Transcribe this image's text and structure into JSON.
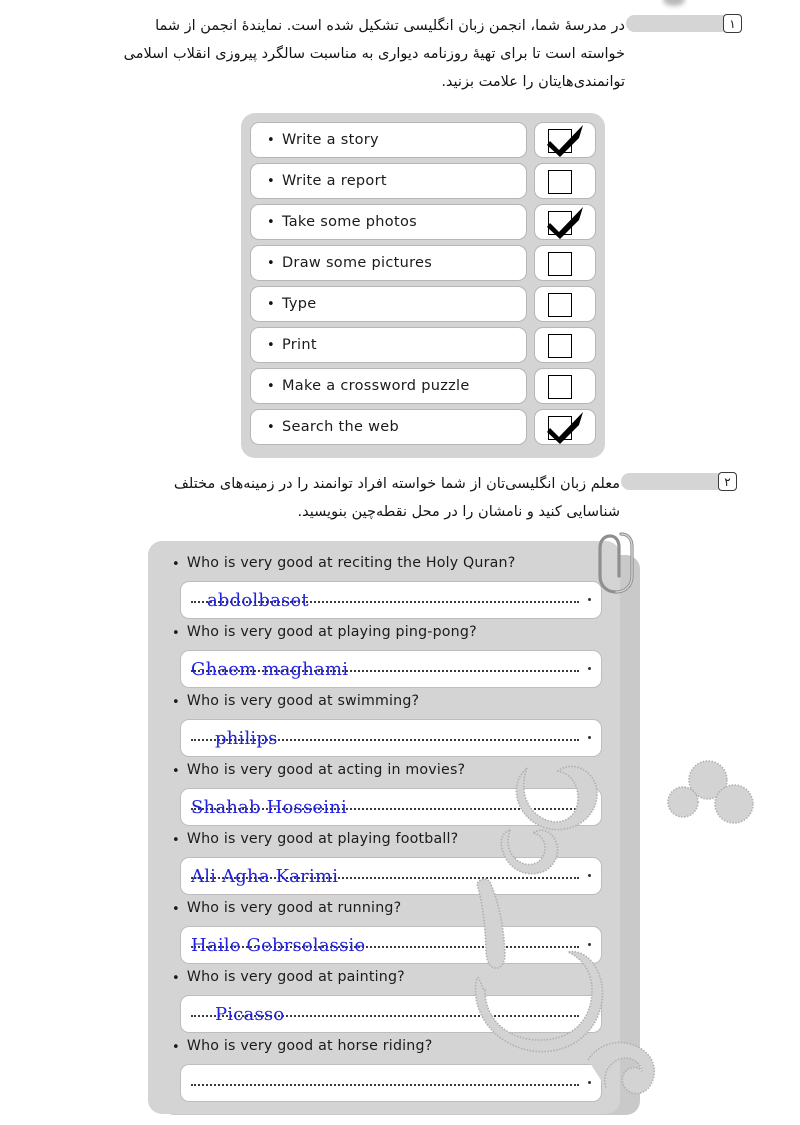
{
  "page": {
    "background_color": "#ffffff",
    "panel_color": "#d4d4d4",
    "field_color": "#ffffff",
    "answer_ink_color": "#2020e0",
    "text_color": "#1b1b1b"
  },
  "exercise1": {
    "number_badge": "۱",
    "instruction_lines": [
      "در مدرسهٔ شما، انجمن زبان انگلیسی تشکیل شده است. نمایندهٔ انجمن از شما",
      "خواسته است تا برای تهیهٔ روزنامه دیواری به مناسبت سالگرد پیروزی انقلاب اسلامی",
      "توانمندی‌هایتان را علامت بزنید."
    ],
    "items": [
      {
        "label": "Write a story",
        "checked": true
      },
      {
        "label": "Write a report",
        "checked": false
      },
      {
        "label": "Take some photos",
        "checked": true
      },
      {
        "label": "Draw some pictures",
        "checked": false
      },
      {
        "label": "Type",
        "checked": false
      },
      {
        "label": "Print",
        "checked": false
      },
      {
        "label": "Make a crossword puzzle",
        "checked": false
      },
      {
        "label": "Search the web",
        "checked": true
      }
    ]
  },
  "exercise2": {
    "number_badge": "۲",
    "instruction_lines": [
      "معلم زبان انگلیسی‌تان از شما خواسته افراد توانمند را در زمینه‌های مختلف",
      "شناسایی کنید و نامشان را در محل نقطه‌چین بنویسید."
    ],
    "questions": [
      {
        "question": "Who is very good at reciting the Holy Quran?",
        "answer": "abdolbaset",
        "indent": 1
      },
      {
        "question": "Who is very good at playing ping-pong?",
        "answer": "Ghaem  maghami",
        "indent": 0
      },
      {
        "question": "Who is very good at swimming?",
        "answer": "philips",
        "indent": 2
      },
      {
        "question": "Who is very good at acting in movies?",
        "answer": "Shahab Hosseini",
        "indent": 0
      },
      {
        "question": "Who is very good at playing football?",
        "answer": "Ali Agha Karimi",
        "indent": 0
      },
      {
        "question": "Who is very good at running?",
        "answer": "Haile Gebrselassie",
        "indent": 0
      },
      {
        "question": "Who is very good at painting?",
        "answer": "Picasso",
        "indent": 2
      },
      {
        "question": "Who is very good at horse riding?",
        "answer": "",
        "indent": 0
      }
    ]
  },
  "bullet_glyph": "•"
}
